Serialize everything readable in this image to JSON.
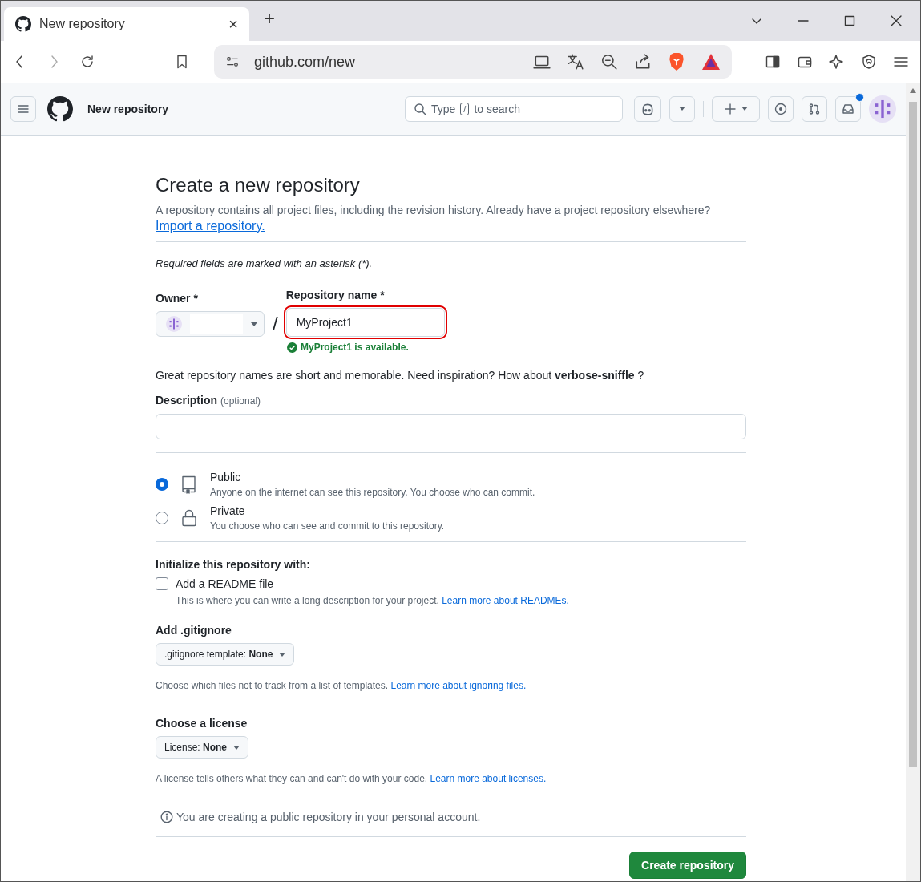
{
  "browser": {
    "tab_title": "New repository",
    "close_tab": "×",
    "new_tab": "+",
    "address": "github.com/new"
  },
  "header": {
    "title": "New repository",
    "search": {
      "before": "Type",
      "key": "/",
      "after": "to search"
    },
    "inbox_unread": true
  },
  "page": {
    "title": "Create a new repository",
    "intro": "A repository contains all project files, including the revision history. Already have a project repository elsewhere?",
    "import_link": "Import a repository.",
    "required_note": "Required fields are marked with an asterisk (*).",
    "owner": {
      "label": "Owner *"
    },
    "separator": "/",
    "repo_name": {
      "label": "Repository name *",
      "value": "MyProject1",
      "highlighted": true
    },
    "availability": "MyProject1 is available.",
    "suggestion": "Great repository names are short and memorable. Need inspiration? How about **verbose-sniffle** ?",
    "description": {
      "label": "Description",
      "hint": "(optional)"
    },
    "visibility": [
      {
        "kind": "book",
        "label": "Public",
        "description": "Anyone on the internet can see this repository. You choose who can commit.",
        "selected": true
      },
      {
        "kind": "lock",
        "label": "Private",
        "description": "You choose who can see and commit to this repository.",
        "selected": false
      }
    ],
    "init_heading": "Initialize this repository with:",
    "readme": {
      "label": "Add a README file",
      "checked": false,
      "description": "This is where you can write a long description for your project.",
      "link": "Learn more about READMEs."
    },
    "gitignore": {
      "heading": "Add .gitignore",
      "select_label": ".gitignore template:",
      "select_value": "None",
      "description": "Choose which files not to track from a list of templates.",
      "link": "Learn more about ignoring files."
    },
    "license": {
      "heading": "Choose a license",
      "select_label": "License:",
      "select_value": "None",
      "description": "A license tells others what they can and can't do with your code.",
      "link": "Learn more about licenses."
    },
    "notice": "You are creating a public repository in your personal account.",
    "submit": "Create repository"
  }
}
